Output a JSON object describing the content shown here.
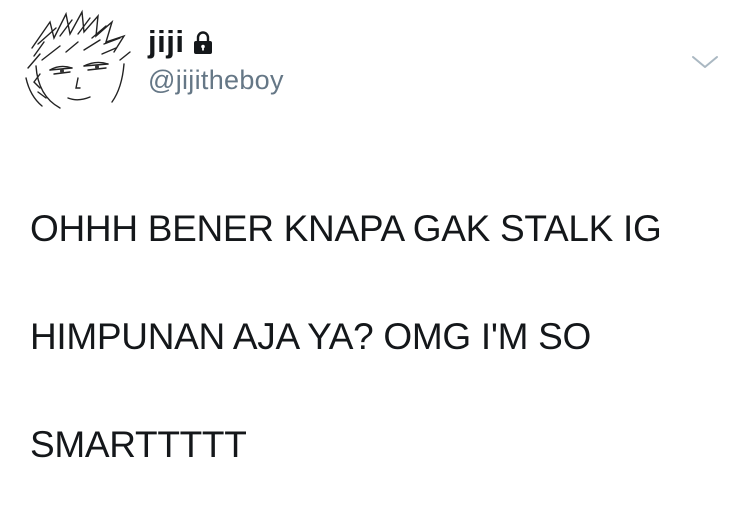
{
  "tweet": {
    "author": {
      "display_name": "jiji",
      "handle": "@jijitheboy",
      "protected_icon": "lock-icon",
      "avatar_icon": "sketch-avatar"
    },
    "text_lines": [
      "OHHH BENER KNAPA GAK STALK IG",
      "HIMPUNAN AJA YA? OMG I'M SO",
      "SMARTTTTT"
    ],
    "menu_icon": "chevron-down-icon"
  },
  "colors": {
    "text_primary": "#14171a",
    "text_secondary": "#657786",
    "chevron": "#aab8c2",
    "background": "#ffffff"
  }
}
